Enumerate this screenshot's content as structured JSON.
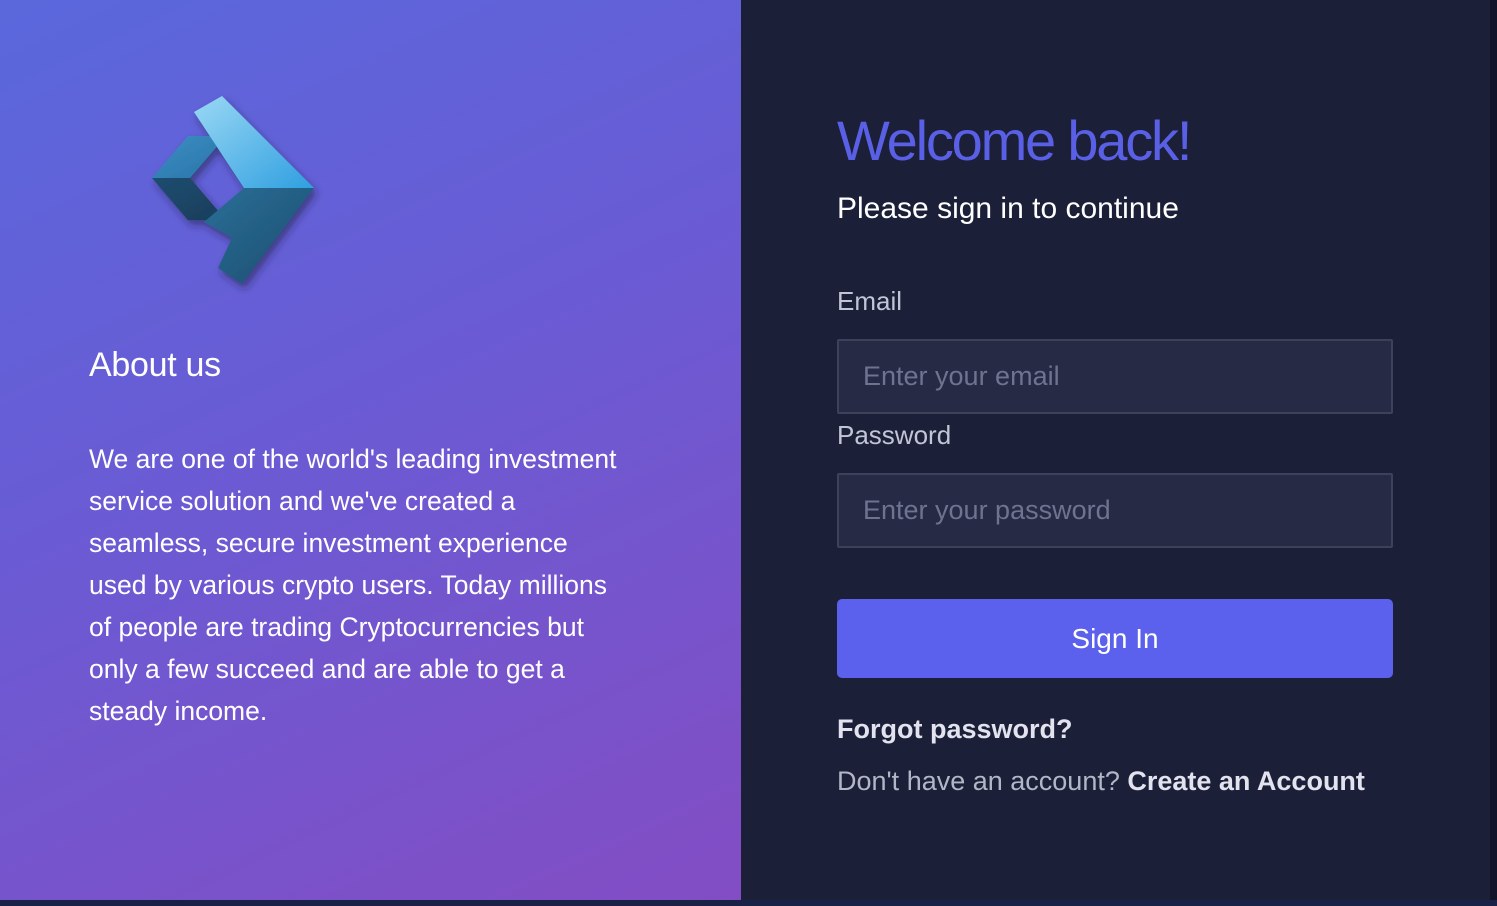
{
  "about": {
    "logo_icon": "double-chevron-right-icon",
    "title": "About us",
    "text": "We are one of the world's leading investment service solution and we've created a seamless, secure investment experience used by various crypto users. Today millions of people are trading Cryptocurrencies but only a few succeed and are able to get a steady income."
  },
  "login": {
    "title": "Welcome back!",
    "subtitle": "Please sign in to continue",
    "email_label": "Email",
    "email_placeholder": "Enter your email",
    "email_value": "",
    "password_label": "Password",
    "password_placeholder": "Enter your password",
    "password_value": "",
    "signin_label": "Sign In",
    "forgot_label": "Forgot password?",
    "no_account_text": "Don't have an account?",
    "create_account_label": "Create an Account"
  },
  "colors": {
    "accent": "#5b61ec",
    "title": "#5a60e6",
    "panel_bg": "#1b1f38",
    "gradient_start": "#5a68dc",
    "gradient_end": "#834dc4"
  }
}
